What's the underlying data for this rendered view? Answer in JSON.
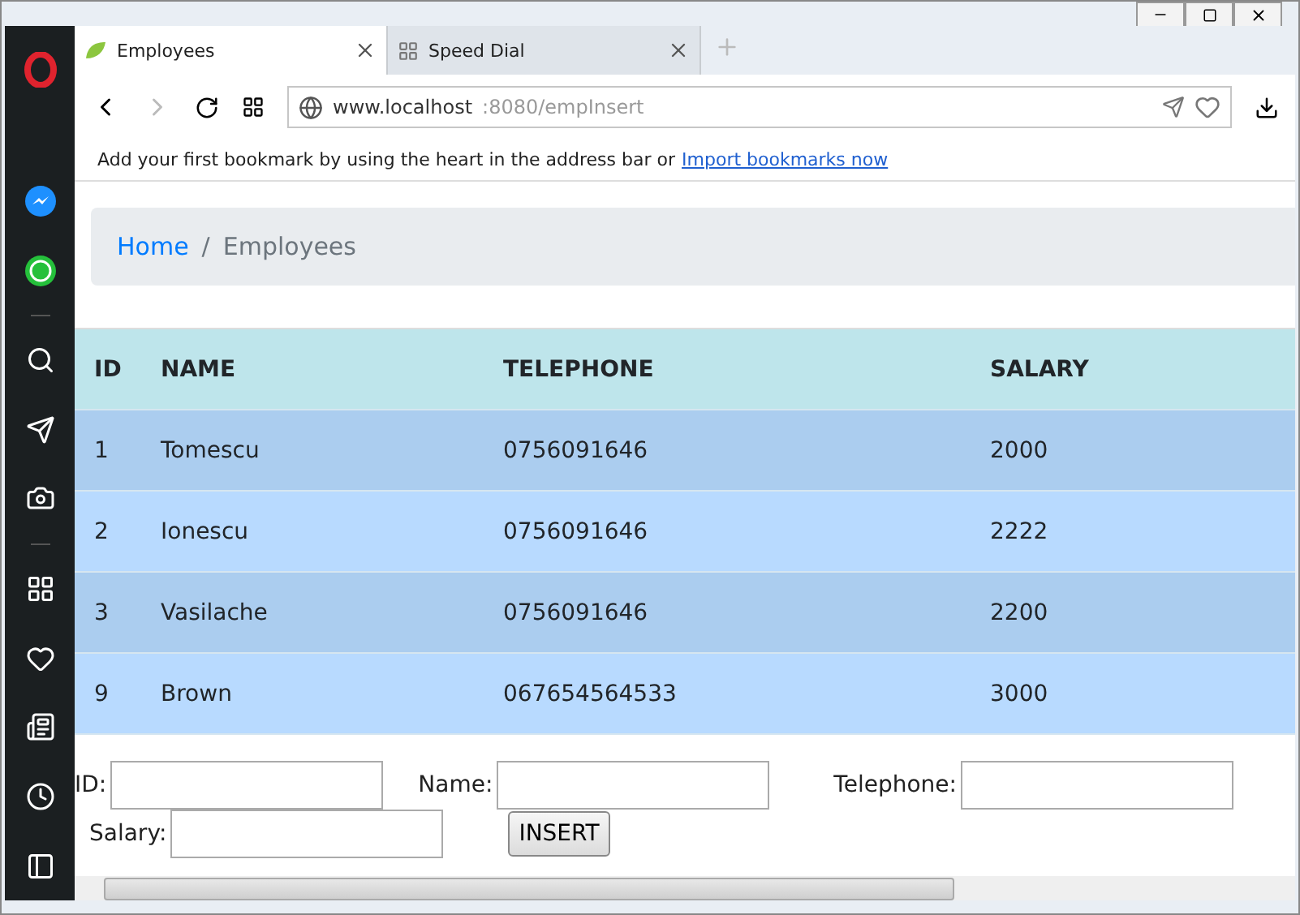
{
  "tabs": [
    {
      "label": "Employees",
      "selected": true
    },
    {
      "label": "Speed Dial",
      "selected": false
    }
  ],
  "address": {
    "host": "www.localhost",
    "path": ":8080/empInsert"
  },
  "bookmark_bar": {
    "text": "Add your first bookmark by using the heart in the address bar or",
    "link": "Import bookmarks now"
  },
  "breadcrumb": [
    {
      "label": "Home",
      "selected": false
    },
    {
      "label": "Employees",
      "selected": true
    }
  ],
  "breadcrumb_separator": "/",
  "table": {
    "columns": [
      "ID",
      "NAME",
      "TELEPHONE",
      "SALARY"
    ],
    "rows": [
      [
        "1",
        "Tomescu",
        "0756091646",
        "2000"
      ],
      [
        "2",
        "Ionescu",
        "0756091646",
        "2222"
      ],
      [
        "3",
        "Vasilache",
        "0756091646",
        "2200"
      ],
      [
        "9",
        "Brown",
        "067654564533",
        "3000"
      ]
    ]
  },
  "form": {
    "fields": [
      {
        "label": "ID:"
      },
      {
        "label": "Name:"
      },
      {
        "label": "Telephone:"
      },
      {
        "label": "Salary:"
      }
    ],
    "button": "INSERT"
  }
}
